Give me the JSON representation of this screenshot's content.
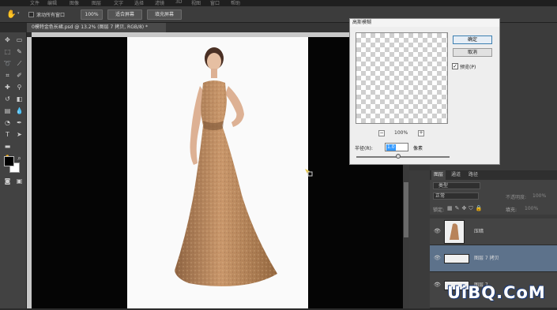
{
  "menubar": {
    "items": [
      "文件",
      "编辑",
      "图像",
      "图层",
      "文字",
      "选择",
      "滤镜",
      "3D",
      "视图",
      "窗口",
      "帮助"
    ]
  },
  "options_bar": {
    "tool_icon": "hand-icon",
    "scroll_all_windows_label": "滚动所有窗口",
    "scroll_all_windows_checked": false,
    "zoom_100_label": "100%",
    "fit_screen_label": "适合屏幕",
    "fill_screen_label": "填充屏幕"
  },
  "document": {
    "tab_title": "0模特金色长裙.psd @ 13.2% (图层 7 拷贝, RGB/8) *"
  },
  "gaussian_blur_dialog": {
    "title": "高斯模糊",
    "ok_label": "确定",
    "cancel_label": "取消",
    "preview_label": "预览(P)",
    "preview_checked": true,
    "zoom_level": "100%",
    "zoom_out_label": "−",
    "zoom_in_label": "+",
    "radius_label": "半径(R):",
    "radius_value": "1.0",
    "radius_unit": "像素",
    "slider_fraction": 0.45
  },
  "layers_panel": {
    "tabs": [
      "图层",
      "通道",
      "路径"
    ],
    "filter_kind": "类型",
    "blend_mode": "正常",
    "opacity_label": "不透明度:",
    "opacity_value": "100%",
    "lock_label": "锁定:",
    "fill_label": "填充:",
    "fill_value": "100%",
    "layers": [
      {
        "name": "压暗",
        "visible": true,
        "selected": false
      },
      {
        "name": "图层 7 拷贝",
        "visible": true,
        "selected": true
      },
      {
        "name": "图层 7",
        "visible": true,
        "selected": false
      }
    ]
  },
  "watermark": {
    "text": "UiBQ.CoM"
  },
  "colors": {
    "canvas_bg": "#050505",
    "document_bg": "#fafafa",
    "dress": "#b8835a",
    "selected_layer": "#5d728b",
    "dialog_bg": "#eeeeee",
    "highlight": "#3399ff"
  }
}
